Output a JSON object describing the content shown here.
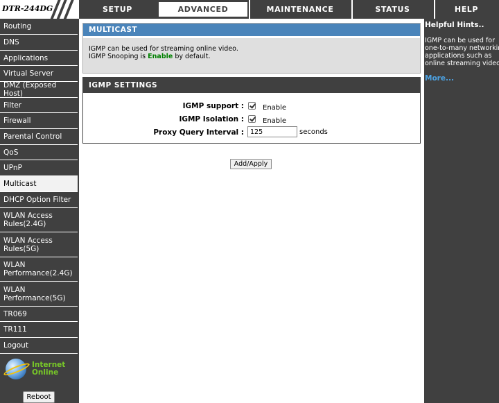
{
  "header": {
    "logo_text": "DTR-244DG",
    "tabs": [
      {
        "label": "SETUP"
      },
      {
        "label": "ADVANCED"
      },
      {
        "label": "MAINTENANCE"
      },
      {
        "label": "STATUS"
      },
      {
        "label": "HELP"
      }
    ]
  },
  "sidebar": {
    "items": [
      {
        "label": "Routing"
      },
      {
        "label": "DNS"
      },
      {
        "label": "Applications"
      },
      {
        "label": "Virtual Server"
      },
      {
        "label": "DMZ (Exposed Host)"
      },
      {
        "label": "Filter"
      },
      {
        "label": "Firewall"
      },
      {
        "label": "Parental Control"
      },
      {
        "label": "QoS"
      },
      {
        "label": "UPnP"
      },
      {
        "label": "Multicast"
      },
      {
        "label": "DHCP Option Filter"
      },
      {
        "label": "WLAN Access",
        "label2": "Rules(2.4G)"
      },
      {
        "label": "WLAN Access",
        "label2": "Rules(5G)"
      },
      {
        "label": "WLAN",
        "label2": "Performance(2.4G)"
      },
      {
        "label": "WLAN",
        "label2": "Performance(5G)"
      },
      {
        "label": "TR069"
      },
      {
        "label": "TR111"
      },
      {
        "label": "Logout"
      }
    ],
    "active": "Multicast",
    "status_line1": "Internet",
    "status_line2": "Online",
    "reboot_label": "Reboot",
    "status_icon": "globe-icon"
  },
  "multicast": {
    "title": "MULTICAST",
    "desc1": "IGMP can be used for streaming online video.",
    "desc2_prefix": "IGMP Snooping is",
    "desc2_highlight": "Enable",
    "desc2_suffix": "by default."
  },
  "igmp_settings": {
    "title": "IGMP SETTINGS",
    "support_label": "IGMP support :",
    "support_checked": true,
    "support_option": "Enable",
    "isolation_label": "IGMP Isolation :",
    "isolation_checked": true,
    "isolation_option": "Enable",
    "proxy_label": "Proxy Query Interval :",
    "proxy_value": "125",
    "proxy_unit": "seconds"
  },
  "apply_label": "Add/Apply",
  "hints": {
    "title": "Helpful Hints..",
    "text": "IGMP can be used for one-to-many networking applications such as online streaming video.",
    "more": "More..."
  },
  "colors": {
    "dark": "#404040",
    "accent_blue": "#4a84ba",
    "status_green": "#78c828",
    "highlight_green": "#008000",
    "link_blue": "#4ca3e4"
  }
}
